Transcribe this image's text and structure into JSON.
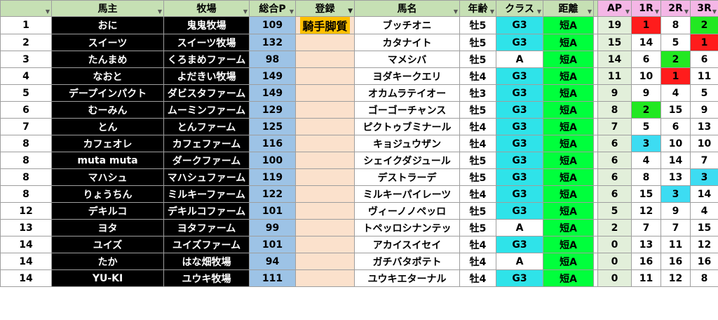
{
  "headers": {
    "rank": "",
    "owner": "馬主",
    "ranch": "牧場",
    "total": "総合P",
    "reg": "登録",
    "horse": "馬名",
    "age": "年齢",
    "cls": "クラス",
    "dist": "距離",
    "ap": "AP",
    "r1": "1R",
    "r2": "2R",
    "r3": "3R"
  },
  "rows": [
    {
      "rank": "1",
      "owner": "おに",
      "ranch": "鬼鬼牧場",
      "total": "109",
      "reg": "騎手脚質",
      "horse": "ブッチオニ",
      "age": "牡5",
      "cls": "G3",
      "dist": "短A",
      "ap": "19",
      "r1": "1",
      "r2": "8",
      "r3": "2"
    },
    {
      "rank": "2",
      "owner": "スイーツ",
      "ranch": "スイーツ牧場",
      "total": "132",
      "reg": "",
      "horse": "カタナイト",
      "age": "牡5",
      "cls": "G3",
      "dist": "短A",
      "ap": "15",
      "r1": "14",
      "r2": "5",
      "r3": "1"
    },
    {
      "rank": "3",
      "owner": "たんまめ",
      "ranch": "くろまめファーム",
      "total": "98",
      "reg": "",
      "horse": "マメシバ",
      "age": "牡5",
      "cls": "A",
      "dist": "短A",
      "ap": "14",
      "r1": "6",
      "r2": "2",
      "r3": "6"
    },
    {
      "rank": "4",
      "owner": "なおと",
      "ranch": "よだきい牧場",
      "total": "149",
      "reg": "",
      "horse": "ヨダキークエリ",
      "age": "牡4",
      "cls": "G3",
      "dist": "短A",
      "ap": "11",
      "r1": "10",
      "r2": "1",
      "r3": "11"
    },
    {
      "rank": "5",
      "owner": "デープインパクト",
      "ranch": "ダビスタファーム",
      "total": "149",
      "reg": "",
      "horse": "オカムラテイオー",
      "age": "牡3",
      "cls": "G3",
      "dist": "短A",
      "ap": "9",
      "r1": "9",
      "r2": "4",
      "r3": "5"
    },
    {
      "rank": "6",
      "owner": "むーみん",
      "ranch": "ムーミンファーム",
      "total": "129",
      "reg": "",
      "horse": "ゴーゴーチャンス",
      "age": "牡5",
      "cls": "G3",
      "dist": "短A",
      "ap": "8",
      "r1": "2",
      "r2": "15",
      "r3": "9"
    },
    {
      "rank": "7",
      "owner": "とん",
      "ranch": "とんファーム",
      "total": "125",
      "reg": "",
      "horse": "ピクトゥブミナール",
      "age": "牡4",
      "cls": "G3",
      "dist": "短A",
      "ap": "7",
      "r1": "5",
      "r2": "6",
      "r3": "13"
    },
    {
      "rank": "8",
      "owner": "カフェオレ",
      "ranch": "カフェファーム",
      "total": "116",
      "reg": "",
      "horse": "キョジュウザン",
      "age": "牡4",
      "cls": "G3",
      "dist": "短A",
      "ap": "6",
      "r1": "3",
      "r2": "10",
      "r3": "10"
    },
    {
      "rank": "8",
      "owner": "muta muta",
      "ranch": "ダークファーム",
      "total": "100",
      "reg": "",
      "horse": "シェイクダジュール",
      "age": "牡5",
      "cls": "G3",
      "dist": "短A",
      "ap": "6",
      "r1": "4",
      "r2": "14",
      "r3": "7"
    },
    {
      "rank": "8",
      "owner": "マハシュ",
      "ranch": "マハシュファーム",
      "total": "119",
      "reg": "",
      "horse": "デストラーデ",
      "age": "牡5",
      "cls": "G3",
      "dist": "短A",
      "ap": "6",
      "r1": "8",
      "r2": "13",
      "r3": "3"
    },
    {
      "rank": "8",
      "owner": "りょうちん",
      "ranch": "ミルキーファーム",
      "total": "122",
      "reg": "",
      "horse": "ミルキーパイレーツ",
      "age": "牡4",
      "cls": "G3",
      "dist": "短A",
      "ap": "6",
      "r1": "15",
      "r2": "3",
      "r3": "14"
    },
    {
      "rank": "12",
      "owner": "デキルコ",
      "ranch": "デキルコファーム",
      "total": "101",
      "reg": "",
      "horse": "ヴィーノノペッロ",
      "age": "牡5",
      "cls": "G3",
      "dist": "短A",
      "ap": "5",
      "r1": "12",
      "r2": "9",
      "r3": "4"
    },
    {
      "rank": "13",
      "owner": "ヨタ",
      "ranch": "ヨタファーム",
      "total": "99",
      "reg": "",
      "horse": "トペッロシナンテッ",
      "age": "牡5",
      "cls": "A",
      "dist": "短A",
      "ap": "2",
      "r1": "7",
      "r2": "7",
      "r3": "15"
    },
    {
      "rank": "14",
      "owner": "ユイズ",
      "ranch": "ユイズファーム",
      "total": "101",
      "reg": "",
      "horse": "アカイスイセイ",
      "age": "牡4",
      "cls": "G3",
      "dist": "短A",
      "ap": "0",
      "r1": "13",
      "r2": "11",
      "r3": "12"
    },
    {
      "rank": "14",
      "owner": "たか",
      "ranch": "はな畑牧場",
      "total": "94",
      "reg": "",
      "horse": "ガチバタポテト",
      "age": "牡4",
      "cls": "A",
      "dist": "短A",
      "ap": "0",
      "r1": "16",
      "r2": "16",
      "r3": "16"
    },
    {
      "rank": "14",
      "owner": "YU-KI",
      "ranch": "ユウキ牧場",
      "total": "111",
      "reg": "",
      "horse": "ユウキエターナル",
      "age": "牡4",
      "cls": "G3",
      "dist": "短A",
      "ap": "0",
      "r1": "11",
      "r2": "12",
      "r3": "8"
    }
  ],
  "colors": {
    "header_bg": "#c6e0b4",
    "owner_bg": "#000000",
    "total_bg": "#9dc3e6",
    "reg_bg": "#fbe1cc",
    "badge_bg": "#ffc000",
    "g3_bg": "#2fe3e9",
    "dist_bg": "#00ff3c",
    "ap_bg": "#e2efda",
    "place1": "#ff1c1c",
    "place2": "#22e822",
    "place3": "#3ddcf2"
  },
  "icons": {
    "filter": "dropdown-filter-icon",
    "filter_active": "active-filter-icon"
  }
}
